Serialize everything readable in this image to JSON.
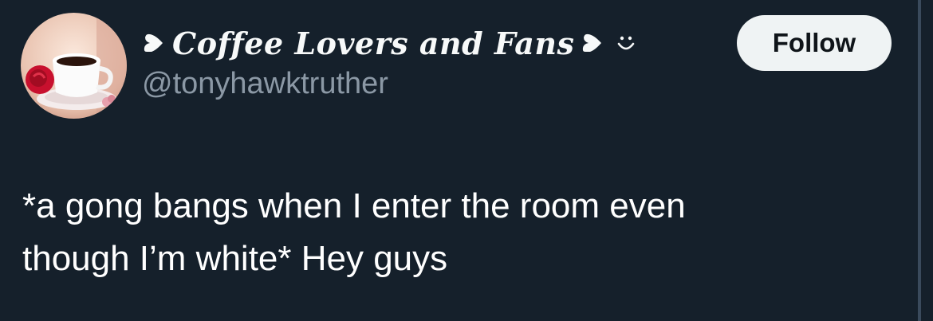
{
  "tweet": {
    "author": {
      "display_name": "Coffee Lovers and Fans",
      "handle": "@tonyhawktruther",
      "avatar_icon": "coffee-cup-rose-avatar",
      "name_prefix_icon": "heart-icon",
      "name_suffix_icons": [
        "heart-icon",
        "smile-icon"
      ]
    },
    "follow_label": "Follow",
    "text": "*a gong bangs when I enter the room even\nthough I’m white* Hey guys"
  },
  "colors": {
    "background": "#15202b",
    "text_primary": "#ffffff",
    "text_secondary": "#8b98a5",
    "button_bg": "#eff3f4",
    "button_text": "#0f1419"
  }
}
